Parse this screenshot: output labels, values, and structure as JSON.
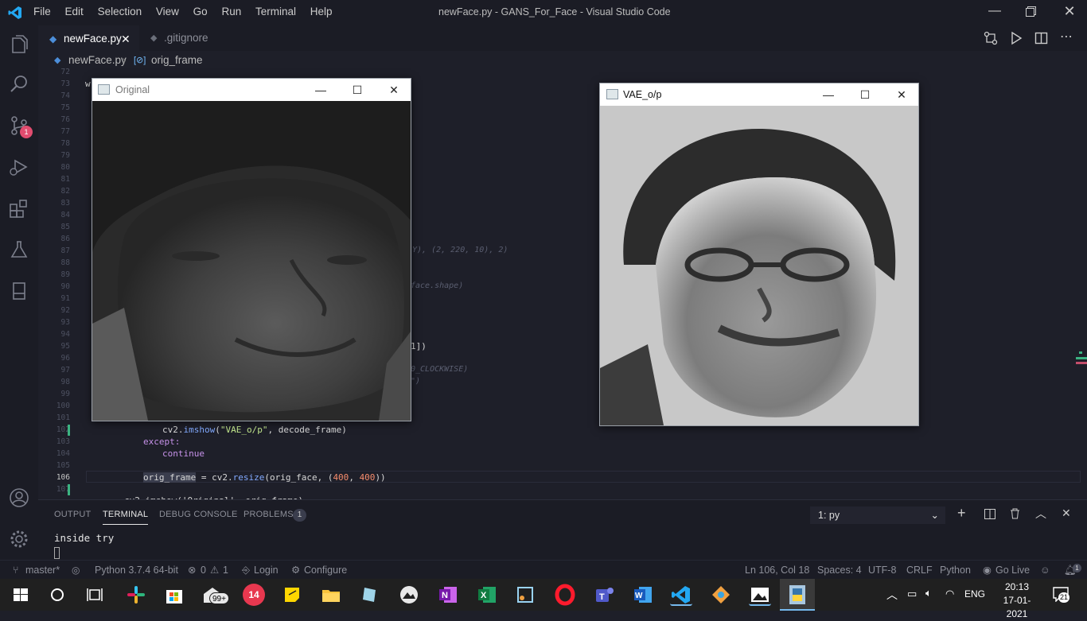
{
  "window": {
    "title": "newFace.py - GANS_For_Face - Visual Studio Code"
  },
  "menu": [
    "File",
    "Edit",
    "Selection",
    "View",
    "Go",
    "Run",
    "Terminal",
    "Help"
  ],
  "tabs": [
    {
      "label": "newFace.py",
      "active": true
    },
    {
      "label": ".gitignore",
      "active": false
    }
  ],
  "breadcrumb": {
    "file": "newFace.py",
    "symbol": "orig_frame"
  },
  "activity": {
    "scm_badge": "1"
  },
  "editor": {
    "line_numbers": [
      "72",
      "73",
      "74",
      "75",
      "76",
      "77",
      "78",
      "79",
      "80",
      "81",
      "82",
      "83",
      "84",
      "85",
      "86",
      "87",
      "88",
      "89",
      "90",
      "91",
      "92",
      "93",
      "94",
      "95",
      "96",
      "97",
      "98",
      "99",
      "100",
      "101",
      "102",
      "103",
      "104",
      "105",
      "106",
      "107"
    ],
    "visible_fragments": {
      "l73": "w",
      "l87": "Y), (2, 220, 10), 2)",
      "l90": "face.shape)",
      "l95": "1])",
      "l97": "0_CLOCKWISE)",
      "l98": "\")",
      "l102_a": "cv2.",
      "l102_b": "imshow",
      "l102_c": "(",
      "l102_d": "\"VAE_o/p\"",
      "l102_e": ", decode_frame)",
      "l103": "except:",
      "l104": "continue",
      "l106_a": "orig_frame",
      "l106_b": " = cv2.",
      "l106_c": "resize",
      "l106_d": "(orig_face, (",
      "l106_e": "400",
      "l106_f": ", ",
      "l106_g": "400",
      "l106_h": "))",
      "l108": "cv2.imshow('Original', orig_frame)"
    }
  },
  "cv_windows": [
    {
      "title": "Original"
    },
    {
      "title": "VAE_o/p"
    }
  ],
  "panel": {
    "tabs": [
      "OUTPUT",
      "TERMINAL",
      "DEBUG CONSOLE",
      "PROBLEMS"
    ],
    "problems_count": "1",
    "terminal_select": "1: py",
    "terminal_output": "inside try"
  },
  "status": {
    "branch": "master*",
    "python": "Python 3.7.4 64-bit",
    "errors": "0",
    "warnings": "1",
    "login": "Login",
    "configure": "Configure",
    "position": "Ln 106, Col 18",
    "spaces": "Spaces: 4",
    "encoding": "UTF-8",
    "eol": "CRLF",
    "language": "Python",
    "golive": "Go Live",
    "notif": "1"
  },
  "taskbar": {
    "badge_mail": "99+",
    "badge_14": "14",
    "language": "ENG",
    "time": "20:13",
    "date": "17-01-2021",
    "notif_count": "21"
  },
  "colors": {
    "accent": "#007acc",
    "badge": "#e14c6f",
    "vscode": "#23a8f2"
  }
}
